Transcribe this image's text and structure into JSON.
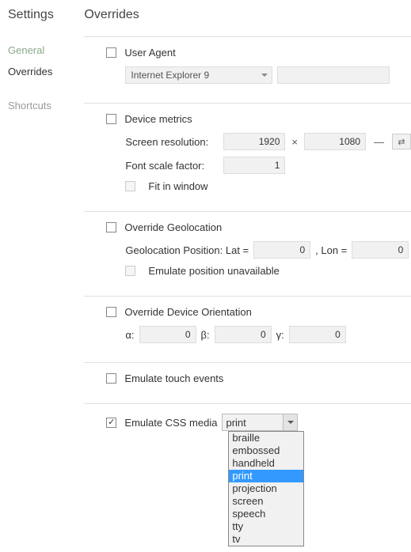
{
  "sidebar": {
    "title": "Settings",
    "items": [
      "General",
      "Overrides",
      "Shortcuts"
    ]
  },
  "main": {
    "title": "Overrides"
  },
  "userAgent": {
    "label": "User Agent",
    "selected": "Internet Explorer 9"
  },
  "deviceMetrics": {
    "label": "Device metrics",
    "resolutionLabel": "Screen resolution:",
    "width": "1920",
    "height": "1080",
    "times": "×",
    "dash": "—",
    "swap": "⇄",
    "scaleLabel": "Font scale factor:",
    "scale": "1",
    "fitLabel": "Fit in window"
  },
  "geolocation": {
    "label": "Override Geolocation",
    "posLabel": "Geolocation Position: Lat =",
    "lat": "0",
    "lonLabel": ", Lon =",
    "lon": "0",
    "emulateLabel": "Emulate position unavailable"
  },
  "orientation": {
    "label": "Override Device Orientation",
    "alpha": "α:",
    "alphaVal": "0",
    "beta": "β:",
    "betaVal": "0",
    "gamma": "γ:",
    "gammaVal": "0"
  },
  "touch": {
    "label": "Emulate touch events"
  },
  "cssMedia": {
    "label": "Emulate CSS media",
    "selected": "print",
    "options": [
      "braille",
      "embossed",
      "handheld",
      "print",
      "projection",
      "screen",
      "speech",
      "tty",
      "tv"
    ]
  }
}
